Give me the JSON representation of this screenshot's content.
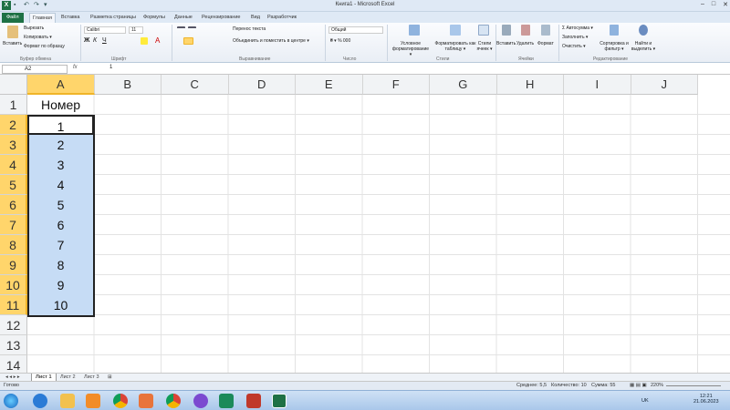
{
  "window": {
    "title": "Книга1 - Microsoft Excel",
    "min": "–",
    "max": "□",
    "close": "✕"
  },
  "tabs": [
    "Файл",
    "Главная",
    "Вставка",
    "Разметка страницы",
    "Формулы",
    "Данные",
    "Рецензирование",
    "Вид",
    "Разработчик"
  ],
  "ribbon": {
    "paste": "Вставить",
    "cut": "Вырезать",
    "copy": "Копировать ▾",
    "format_painter": "Формат по образцу",
    "font_name": "Calibri",
    "font_size": "11",
    "wrap_text": "Перенос текста",
    "merge_center": "Объединить и поместить в центре ▾",
    "number_format": "Общий",
    "cond_format": "Условное форматирование ▾",
    "format_table": "Форматировать как таблицу ▾",
    "cell_styles": "Стили ячеек ▾",
    "insert": "Вставить",
    "delete": "Удалить",
    "format": "Формат",
    "autosum": "Автосумма ▾",
    "fill": "Заполнить ▾",
    "clear": "Очистить ▾",
    "sort_filter": "Сортировка и фильтр ▾",
    "find_select": "Найти и выделить ▾",
    "groups": {
      "clipboard": "Буфер обмена",
      "font": "Шрифт",
      "alignment": "Выравнивание",
      "number": "Число",
      "styles": "Стили",
      "cells": "Ячейки",
      "editing": "Редактирование"
    }
  },
  "formula": {
    "name_box": "A2",
    "fx": "fx",
    "value": "1"
  },
  "columns": [
    "A",
    "B",
    "C",
    "D",
    "E",
    "F",
    "G",
    "H",
    "I",
    "J"
  ],
  "rows": [
    "1",
    "2",
    "3",
    "4",
    "5",
    "6",
    "7",
    "8",
    "9",
    "10",
    "11",
    "12",
    "13",
    "14"
  ],
  "cells": {
    "header": "Номер",
    "values": [
      "1",
      "2",
      "3",
      "4",
      "5",
      "6",
      "7",
      "8",
      "9",
      "10"
    ]
  },
  "sheets": [
    "Лист 1",
    "Лист 2",
    "Лист 3"
  ],
  "status": {
    "ready": "Готово",
    "average": "Среднее: 5,5",
    "count": "Количество: 10",
    "sum": "Сумма: 55",
    "zoom": "220%"
  },
  "clock": {
    "lang": "UK",
    "time": "12:21",
    "date": "21.06.2023"
  },
  "colors": {
    "excel_green": "#1e7145",
    "selection_fill": "#c6dcf5",
    "header_highlight": "#ffd56b"
  }
}
